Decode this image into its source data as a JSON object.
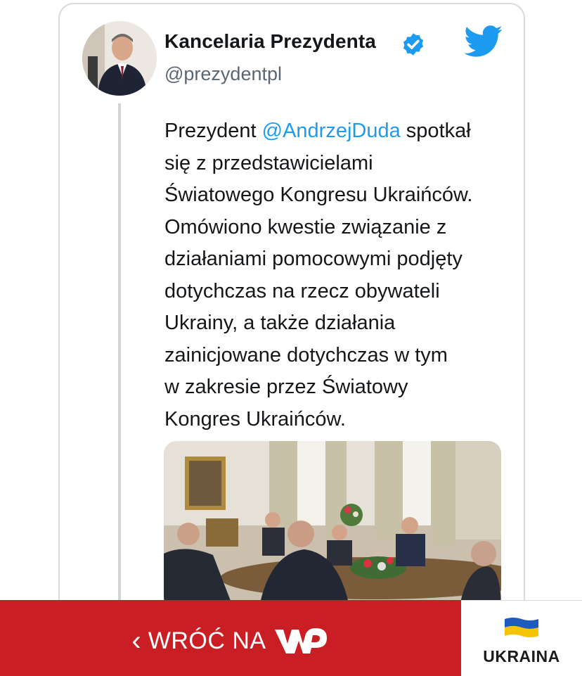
{
  "tweet": {
    "display_name": "Kancelaria Prezydenta",
    "handle": "@prezydentpl",
    "text_before": "Prezydent ",
    "mention": "@AndrzejDuda",
    "text_after": " spotkał\nsię z przedstawicielami\nŚwiatowego Kongresu Ukraińców.\nOmówiono kwestie związanie z\ndziałaniami pomocowymi podjęty\ndotychczas na rzecz obywateli\nUkrainy, a także działania\nzainicjowane dotychczas w tym\nw zakresie przez Światowy\nKongres Ukraińców.",
    "colors": {
      "mention": "#1d9bf0",
      "verified": "#1d9bf0",
      "twitter": "#1d9bf0"
    },
    "icons": [
      "verified-badge-icon",
      "twitter-bird-icon"
    ]
  },
  "bottom_bar": {
    "back_label": "WRÓĆ NA",
    "chevron": "‹",
    "logo_text": "WP",
    "ukraine_label": "UKRAINA",
    "colors": {
      "bar": "#c91f24",
      "flag_top": "#1e5bbf",
      "flag_bottom": "#f5c400"
    }
  }
}
